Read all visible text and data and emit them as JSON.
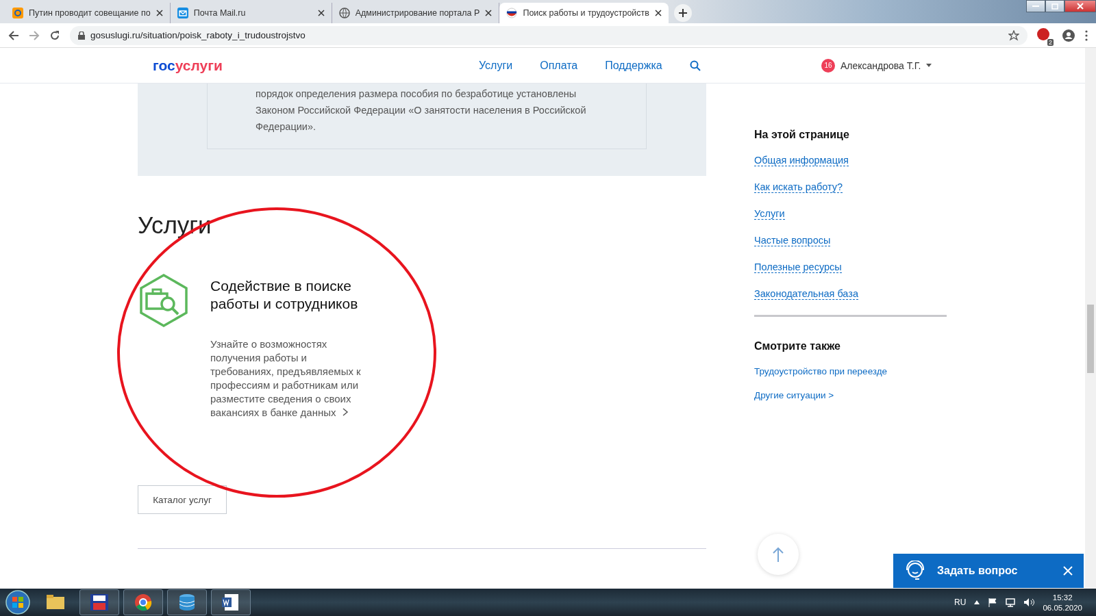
{
  "browser": {
    "tabs": [
      {
        "title": "Путин проводит совещание по",
        "selected": false
      },
      {
        "title": "Почта Mail.ru",
        "selected": false
      },
      {
        "title": "Администрирование портала Р",
        "selected": false
      },
      {
        "title": "Поиск работы и трудоустройств",
        "selected": true
      }
    ],
    "address": "gosuslugi.ru/situation/poisk_raboty_i_trudoustrojstvo",
    "extension_badge": "2"
  },
  "site_header": {
    "logo": {
      "first": "гос",
      "second": "услуги"
    },
    "nav": [
      "Услуги",
      "Оплата",
      "Поддержка"
    ],
    "notifications": "16",
    "user": "Александрова Т.Г."
  },
  "info_text": "порядок определения размера пособия по безработице установлены Законом Российской Федерации «О занятости населения в Российской Федерации».",
  "services": {
    "heading": "Услуги",
    "cards": [
      {
        "title": "Содействие в поиске работы и сотрудников",
        "description": "Узнайте о возможностях получения работы и требованиях, предъявляемых к профессиям и работникам или разместите сведения о своих вакансиях в банке данных"
      }
    ],
    "catalog_button": "Каталог услуг"
  },
  "sidebar": {
    "on_page": {
      "heading": "На этой странице",
      "links": [
        "Общая информация",
        "Как искать работу?",
        "Услуги",
        "Частые вопросы",
        "Полезные ресурсы",
        "Законодательная база"
      ]
    },
    "see_also": {
      "heading": "Смотрите также",
      "links": [
        "Трудоустройство при переезде",
        "Другие ситуации >"
      ]
    }
  },
  "chat": {
    "label": "Задать вопрос"
  },
  "taskbar": {
    "language": "RU",
    "time": "15:32",
    "date": "06.05.2020"
  }
}
